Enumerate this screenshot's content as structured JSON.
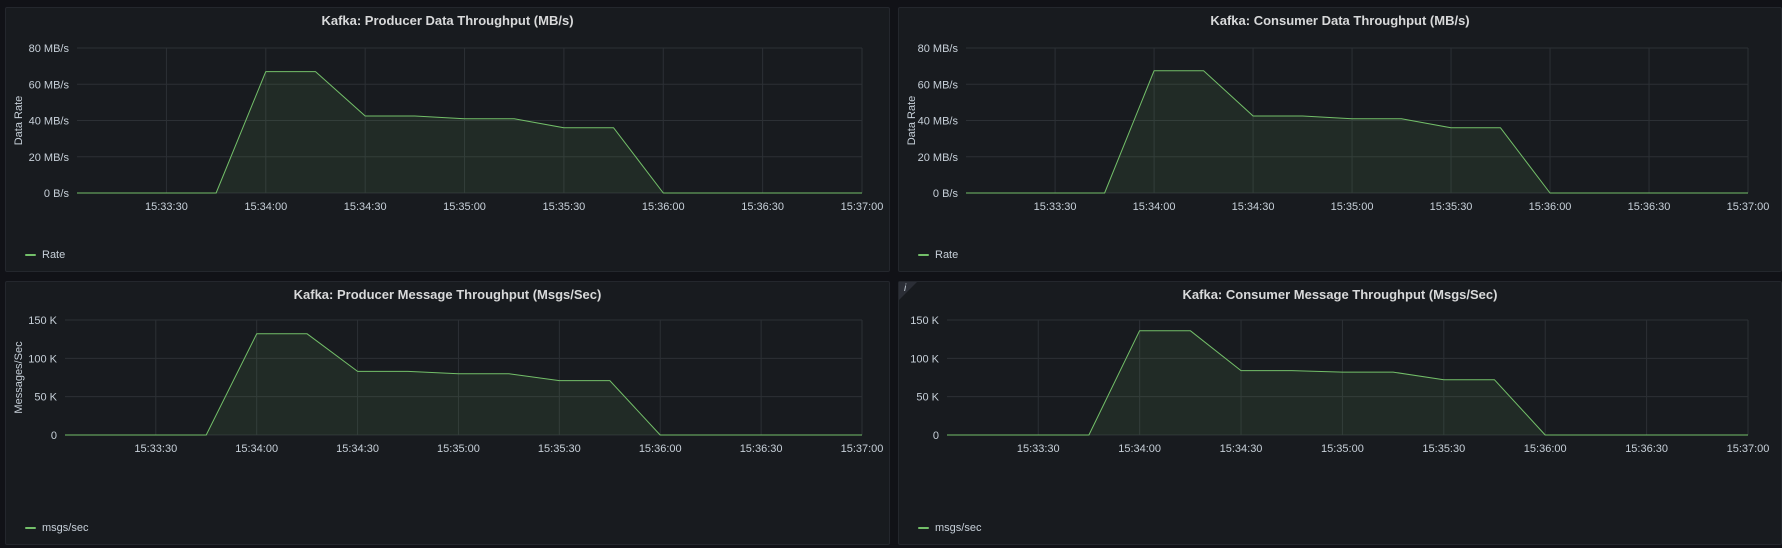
{
  "panels": [
    {
      "title": "Kafka: Producer Data Throughput (MB/s)",
      "legend": "Rate",
      "info": false
    },
    {
      "title": "Kafka: Consumer Data Throughput (MB/s)",
      "legend": "Rate",
      "info": false
    },
    {
      "title": "Kafka: Producer Message Throughput (Msgs/Sec)",
      "legend": "msgs/sec",
      "info": false
    },
    {
      "title": "Kafka: Consumer Message Throughput (Msgs/Sec)",
      "legend": "msgs/sec",
      "info": true
    }
  ],
  "colors": {
    "series": "#73bf69",
    "grid": "#2c3035",
    "tick_text": "#c7d0d9",
    "title": "#d8d9da"
  },
  "chart_data": [
    {
      "type": "area",
      "title": "Kafka: Producer Data Throughput (MB/s)",
      "ylabel": "Data Rate",
      "xlabel": "",
      "x_ticks": [
        "15:33:30",
        "15:34:00",
        "15:34:30",
        "15:35:00",
        "15:35:30",
        "15:36:00",
        "15:36:30",
        "15:37:00"
      ],
      "y_ticks": [
        0,
        20,
        40,
        60,
        80
      ],
      "y_tick_labels": [
        "0 B/s",
        "20 MB/s",
        "40 MB/s",
        "60 MB/s",
        "80 MB/s"
      ],
      "ylim": [
        0,
        80
      ],
      "xlim": [
        "15:33:03",
        "15:37:00"
      ],
      "grid": true,
      "legend_position": "bottom-left",
      "series": [
        {
          "name": "Rate",
          "x": [
            "15:33:45",
            "15:34:00",
            "15:34:15",
            "15:34:30",
            "15:34:45",
            "15:35:00",
            "15:35:15",
            "15:35:30",
            "15:35:45",
            "15:36:00"
          ],
          "values": [
            0,
            67,
            67,
            42.5,
            42.5,
            41,
            41,
            36,
            36,
            0
          ]
        }
      ]
    },
    {
      "type": "area",
      "title": "Kafka: Consumer Data Throughput (MB/s)",
      "ylabel": "Data Rate",
      "xlabel": "",
      "x_ticks": [
        "15:33:30",
        "15:34:00",
        "15:34:30",
        "15:35:00",
        "15:35:30",
        "15:36:00",
        "15:36:30",
        "15:37:00"
      ],
      "y_ticks": [
        0,
        20,
        40,
        60,
        80
      ],
      "y_tick_labels": [
        "0 B/s",
        "20 MB/s",
        "40 MB/s",
        "60 MB/s",
        "80 MB/s"
      ],
      "ylim": [
        0,
        80
      ],
      "xlim": [
        "15:33:03",
        "15:37:00"
      ],
      "grid": true,
      "legend_position": "bottom-left",
      "series": [
        {
          "name": "Rate",
          "x": [
            "15:33:45",
            "15:34:00",
            "15:34:15",
            "15:34:30",
            "15:34:45",
            "15:35:00",
            "15:35:15",
            "15:35:30",
            "15:35:45",
            "15:36:00"
          ],
          "values": [
            0,
            67.5,
            67.5,
            42.5,
            42.5,
            41,
            41,
            36,
            36,
            0
          ]
        }
      ]
    },
    {
      "type": "area",
      "title": "Kafka: Producer Message Throughput (Msgs/Sec)",
      "ylabel": "Messages/Sec",
      "xlabel": "",
      "x_ticks": [
        "15:33:30",
        "15:34:00",
        "15:34:30",
        "15:35:00",
        "15:35:30",
        "15:36:00",
        "15:36:30",
        "15:37:00"
      ],
      "y_ticks": [
        0,
        50000,
        100000,
        150000
      ],
      "y_tick_labels": [
        "0",
        "50 K",
        "100 K",
        "150 K"
      ],
      "ylim": [
        0,
        150000
      ],
      "xlim": [
        "15:33:03",
        "15:37:00"
      ],
      "grid": true,
      "legend_position": "bottom-left",
      "series": [
        {
          "name": "msgs/sec",
          "x": [
            "15:33:45",
            "15:34:00",
            "15:34:15",
            "15:34:30",
            "15:34:45",
            "15:35:00",
            "15:35:15",
            "15:35:30",
            "15:35:45",
            "15:36:00"
          ],
          "values": [
            0,
            132000,
            132000,
            83000,
            83000,
            80000,
            80000,
            71000,
            71000,
            0
          ]
        }
      ]
    },
    {
      "type": "area",
      "title": "Kafka: Consumer Message Throughput (Msgs/Sec)",
      "ylabel": "",
      "xlabel": "",
      "x_ticks": [
        "15:33:30",
        "15:34:00",
        "15:34:30",
        "15:35:00",
        "15:35:30",
        "15:36:00",
        "15:36:30",
        "15:37:00"
      ],
      "y_ticks": [
        0,
        50000,
        100000,
        150000
      ],
      "y_tick_labels": [
        "0",
        "50 K",
        "100 K",
        "150 K"
      ],
      "ylim": [
        0,
        150000
      ],
      "xlim": [
        "15:33:03",
        "15:37:00"
      ],
      "grid": true,
      "legend_position": "bottom-left",
      "series": [
        {
          "name": "msgs/sec",
          "x": [
            "15:33:45",
            "15:34:00",
            "15:34:15",
            "15:34:30",
            "15:34:45",
            "15:35:00",
            "15:35:15",
            "15:35:30",
            "15:35:45",
            "15:36:00"
          ],
          "values": [
            0,
            136000,
            136000,
            84000,
            84000,
            82000,
            82000,
            72000,
            72000,
            0
          ]
        }
      ]
    }
  ]
}
